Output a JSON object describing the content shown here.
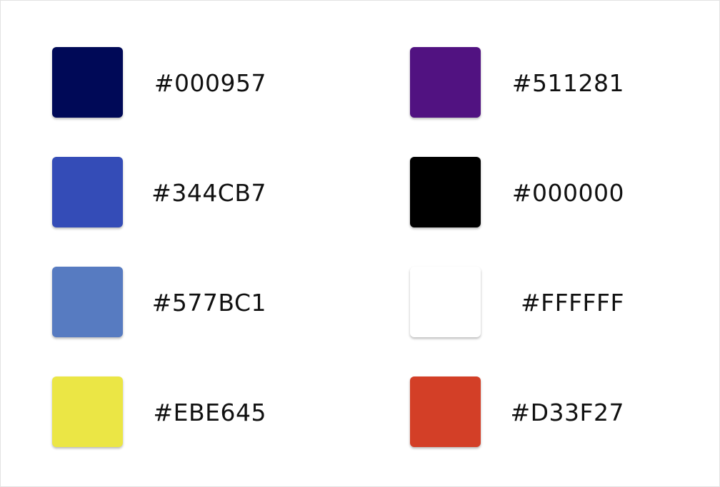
{
  "palette": {
    "left_column": [
      {
        "color": "#000957",
        "label": "#000957"
      },
      {
        "color": "#344CB7",
        "label": "#344CB7"
      },
      {
        "color": "#577BC1",
        "label": "#577BC1"
      },
      {
        "color": "#EBE645",
        "label": "#EBE645"
      }
    ],
    "right_column": [
      {
        "color": "#511281",
        "label": "#511281"
      },
      {
        "color": "#000000",
        "label": "#000000"
      },
      {
        "color": "#FFFFFF",
        "label": "#FFFFFF"
      },
      {
        "color": "#D33F27",
        "label": "#D33F27"
      }
    ]
  }
}
